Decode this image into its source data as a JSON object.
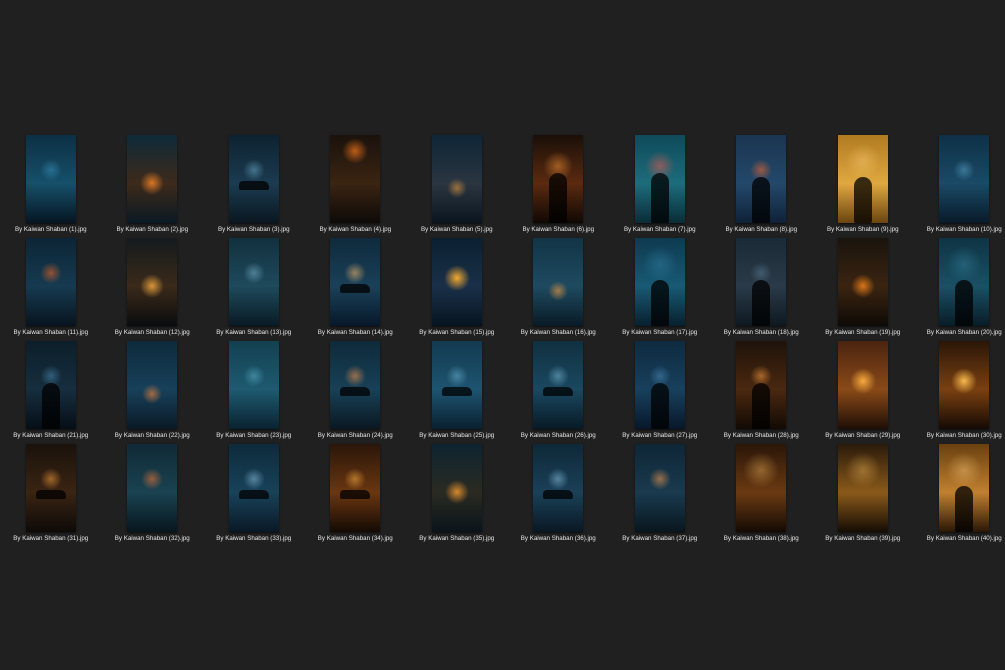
{
  "files": [
    {
      "name": "By Kaiwan Shaban (1).jpg",
      "colors": [
        "#0c2f44",
        "#16506a",
        "#061522"
      ],
      "glow": "#3a8fb8",
      "accent": "city"
    },
    {
      "name": "By Kaiwan Shaban (2).jpg",
      "colors": [
        "#0e2a3a",
        "#3d2a1a",
        "#0a1a24"
      ],
      "glow": "#ff8a2a",
      "accent": "fire"
    },
    {
      "name": "By Kaiwan Shaban (3).jpg",
      "colors": [
        "#0d2230",
        "#1b3b50",
        "#0a1720"
      ],
      "glow": "#6aa7c7",
      "accent": "car"
    },
    {
      "name": "By Kaiwan Shaban (4).jpg",
      "colors": [
        "#1a120c",
        "#3a2412",
        "#0e0a08"
      ],
      "glow": "#ff7a1a",
      "accent": "cinema"
    },
    {
      "name": "By Kaiwan Shaban (5).jpg",
      "colors": [
        "#0f2536",
        "#2a3540",
        "#0b1520"
      ],
      "glow": "#e69a40",
      "accent": "street"
    },
    {
      "name": "By Kaiwan Shaban (6).jpg",
      "colors": [
        "#1a0f08",
        "#5a2a10",
        "#100804"
      ],
      "glow": "#ff9a3a",
      "accent": "face"
    },
    {
      "name": "By Kaiwan Shaban (7).jpg",
      "colors": [
        "#0f4a5a",
        "#1d6c7c",
        "#0a2c36"
      ],
      "glow": "#ff5a4a",
      "accent": "face"
    },
    {
      "name": "By Kaiwan Shaban (8).jpg",
      "colors": [
        "#1a3550",
        "#24486a",
        "#0e2238"
      ],
      "glow": "#ff6a2a",
      "accent": "swim"
    },
    {
      "name": "By Kaiwan Shaban (9).jpg",
      "colors": [
        "#b07a20",
        "#e0a840",
        "#6a4410"
      ],
      "glow": "#ffd27a",
      "accent": "woman"
    },
    {
      "name": "By Kaiwan Shaban (10).jpg",
      "colors": [
        "#0e3046",
        "#1a4a66",
        "#081a28"
      ],
      "glow": "#5aa0c8",
      "accent": "window"
    },
    {
      "name": "By Kaiwan Shaban (11).jpg",
      "colors": [
        "#0c2536",
        "#163a50",
        "#08141e"
      ],
      "glow": "#ff6a20",
      "accent": "cracks"
    },
    {
      "name": "By Kaiwan Shaban (12).jpg",
      "colors": [
        "#141a1e",
        "#3a2a1a",
        "#0a0c0e"
      ],
      "glow": "#ffb040",
      "accent": "fire"
    },
    {
      "name": "By Kaiwan Shaban (13).jpg",
      "colors": [
        "#12303e",
        "#1e4a5c",
        "#0a1a24"
      ],
      "glow": "#7ab0c8",
      "accent": "building"
    },
    {
      "name": "By Kaiwan Shaban (14).jpg",
      "colors": [
        "#0f2a3c",
        "#1a4058",
        "#08182a"
      ],
      "glow": "#ffc070",
      "accent": "car"
    },
    {
      "name": "By Kaiwan Shaban (15).jpg",
      "colors": [
        "#0a2030",
        "#1a3048",
        "#061420"
      ],
      "glow": "#ffb030",
      "accent": "moon"
    },
    {
      "name": "By Kaiwan Shaban (16).jpg",
      "colors": [
        "#123446",
        "#1e4a60",
        "#0a1a26"
      ],
      "glow": "#ffa040",
      "accent": "street"
    },
    {
      "name": "By Kaiwan Shaban (17).jpg",
      "colors": [
        "#0e3a50",
        "#185a74",
        "#08202e"
      ],
      "glow": "#3a8ab0",
      "accent": "woman"
    },
    {
      "name": "By Kaiwan Shaban (18).jpg",
      "colors": [
        "#1a2a36",
        "#2a3a48",
        "#0e1820"
      ],
      "glow": "#5a7a90",
      "accent": "man"
    },
    {
      "name": "By Kaiwan Shaban (19).jpg",
      "colors": [
        "#1a140e",
        "#3a2410",
        "#0e0a06"
      ],
      "glow": "#ff8a1a",
      "accent": "fire"
    },
    {
      "name": "By Kaiwan Shaban (20).jpg",
      "colors": [
        "#0e3444",
        "#1a5064",
        "#081c26"
      ],
      "glow": "#3a8aa8",
      "accent": "woman"
    },
    {
      "name": "By Kaiwan Shaban (21).jpg",
      "colors": [
        "#0c1e2a",
        "#162e3e",
        "#060e16"
      ],
      "glow": "#4a8ab0",
      "accent": "man"
    },
    {
      "name": "By Kaiwan Shaban (22).jpg",
      "colors": [
        "#0e2a3c",
        "#18405a",
        "#0a1a26"
      ],
      "glow": "#ff8a3a",
      "accent": "lights"
    },
    {
      "name": "By Kaiwan Shaban (23).jpg",
      "colors": [
        "#134050",
        "#1e5a70",
        "#0a2230"
      ],
      "glow": "#5ab0c8",
      "accent": "fog"
    },
    {
      "name": "By Kaiwan Shaban (24).jpg",
      "colors": [
        "#0e2a3a",
        "#184056",
        "#0a1822"
      ],
      "glow": "#ff9a50",
      "accent": "car"
    },
    {
      "name": "By Kaiwan Shaban (25).jpg",
      "colors": [
        "#123a50",
        "#1e5470",
        "#0a2030"
      ],
      "glow": "#6ab0d0",
      "accent": "car"
    },
    {
      "name": "By Kaiwan Shaban (26).jpg",
      "colors": [
        "#103040",
        "#1a4860",
        "#081a26"
      ],
      "glow": "#7ab8d8",
      "accent": "car"
    },
    {
      "name": "By Kaiwan Shaban (27).jpg",
      "colors": [
        "#0e2a40",
        "#18405c",
        "#08182a"
      ],
      "glow": "#4a8ab8",
      "accent": "statue"
    },
    {
      "name": "By Kaiwan Shaban (28).jpg",
      "colors": [
        "#1e120a",
        "#4a2810",
        "#120a04"
      ],
      "glow": "#ffa040",
      "accent": "deer"
    },
    {
      "name": "By Kaiwan Shaban (29).jpg",
      "colors": [
        "#4a2410",
        "#8a4a18",
        "#1e0e06"
      ],
      "glow": "#ffb040",
      "accent": "sun"
    },
    {
      "name": "By Kaiwan Shaban (30).jpg",
      "colors": [
        "#2a1608",
        "#7a4010",
        "#140a04"
      ],
      "glow": "#ffc050",
      "accent": "sun"
    },
    {
      "name": "By Kaiwan Shaban (31).jpg",
      "colors": [
        "#1a120c",
        "#3a2412",
        "#0e0a08"
      ],
      "glow": "#ffa040",
      "accent": "car"
    },
    {
      "name": "By Kaiwan Shaban (32).jpg",
      "colors": [
        "#102a36",
        "#1a4250",
        "#08161e"
      ],
      "glow": "#ff7a3a",
      "accent": "forest"
    },
    {
      "name": "By Kaiwan Shaban (33).jpg",
      "colors": [
        "#0e2a3c",
        "#184258",
        "#0a1826"
      ],
      "glow": "#8ac0e0",
      "accent": "car"
    },
    {
      "name": "By Kaiwan Shaban (34).jpg",
      "colors": [
        "#2a160a",
        "#6a3610",
        "#140a04"
      ],
      "glow": "#ffb040",
      "accent": "car"
    },
    {
      "name": "By Kaiwan Shaban (35).jpg",
      "colors": [
        "#0e2430",
        "#2a2a22",
        "#0a141a"
      ],
      "glow": "#ffa030",
      "accent": "fire"
    },
    {
      "name": "By Kaiwan Shaban (36).jpg",
      "colors": [
        "#0e2838",
        "#1a4058",
        "#0a1824"
      ],
      "glow": "#8ac0e0",
      "accent": "car"
    },
    {
      "name": "By Kaiwan Shaban (37).jpg",
      "colors": [
        "#0e2636",
        "#1a3a4e",
        "#08161e"
      ],
      "glow": "#ffa050",
      "accent": "house"
    },
    {
      "name": "By Kaiwan Shaban (38).jpg",
      "colors": [
        "#2a1608",
        "#6a3a12",
        "#140a04"
      ],
      "glow": "#ffc060",
      "accent": "room"
    },
    {
      "name": "By Kaiwan Shaban (39).jpg",
      "colors": [
        "#2a1a0a",
        "#8a5a1a",
        "#140c04"
      ],
      "glow": "#ffc060",
      "accent": "room"
    },
    {
      "name": "By Kaiwan Shaban (40).jpg",
      "colors": [
        "#6a4010",
        "#c08030",
        "#2a1606"
      ],
      "glow": "#ffd080",
      "accent": "woman"
    }
  ]
}
